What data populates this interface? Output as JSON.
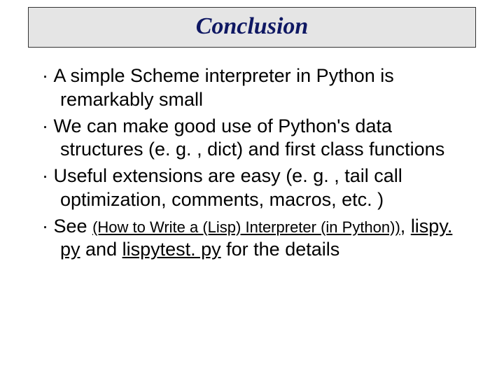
{
  "slide": {
    "title": "Conclusion",
    "bullets": [
      {
        "text": "A simple Scheme interpreter in Python is remarkably small"
      },
      {
        "text": "We can make good use of Python's data structures (e. g. , dict) and first class functions"
      },
      {
        "text": "Useful extensions are easy  (e. g. , tail call optimization, comments, macros, etc. )"
      },
      {
        "prefix": "See ",
        "link1": "(How to Write a (Lisp) Interpreter (in Python))",
        "mid1": ", ",
        "link2": "lispy. py",
        "mid2": " and ",
        "link3": "lispytest. py",
        "suffix": " for the details"
      }
    ],
    "bullet_glyph": "·"
  }
}
